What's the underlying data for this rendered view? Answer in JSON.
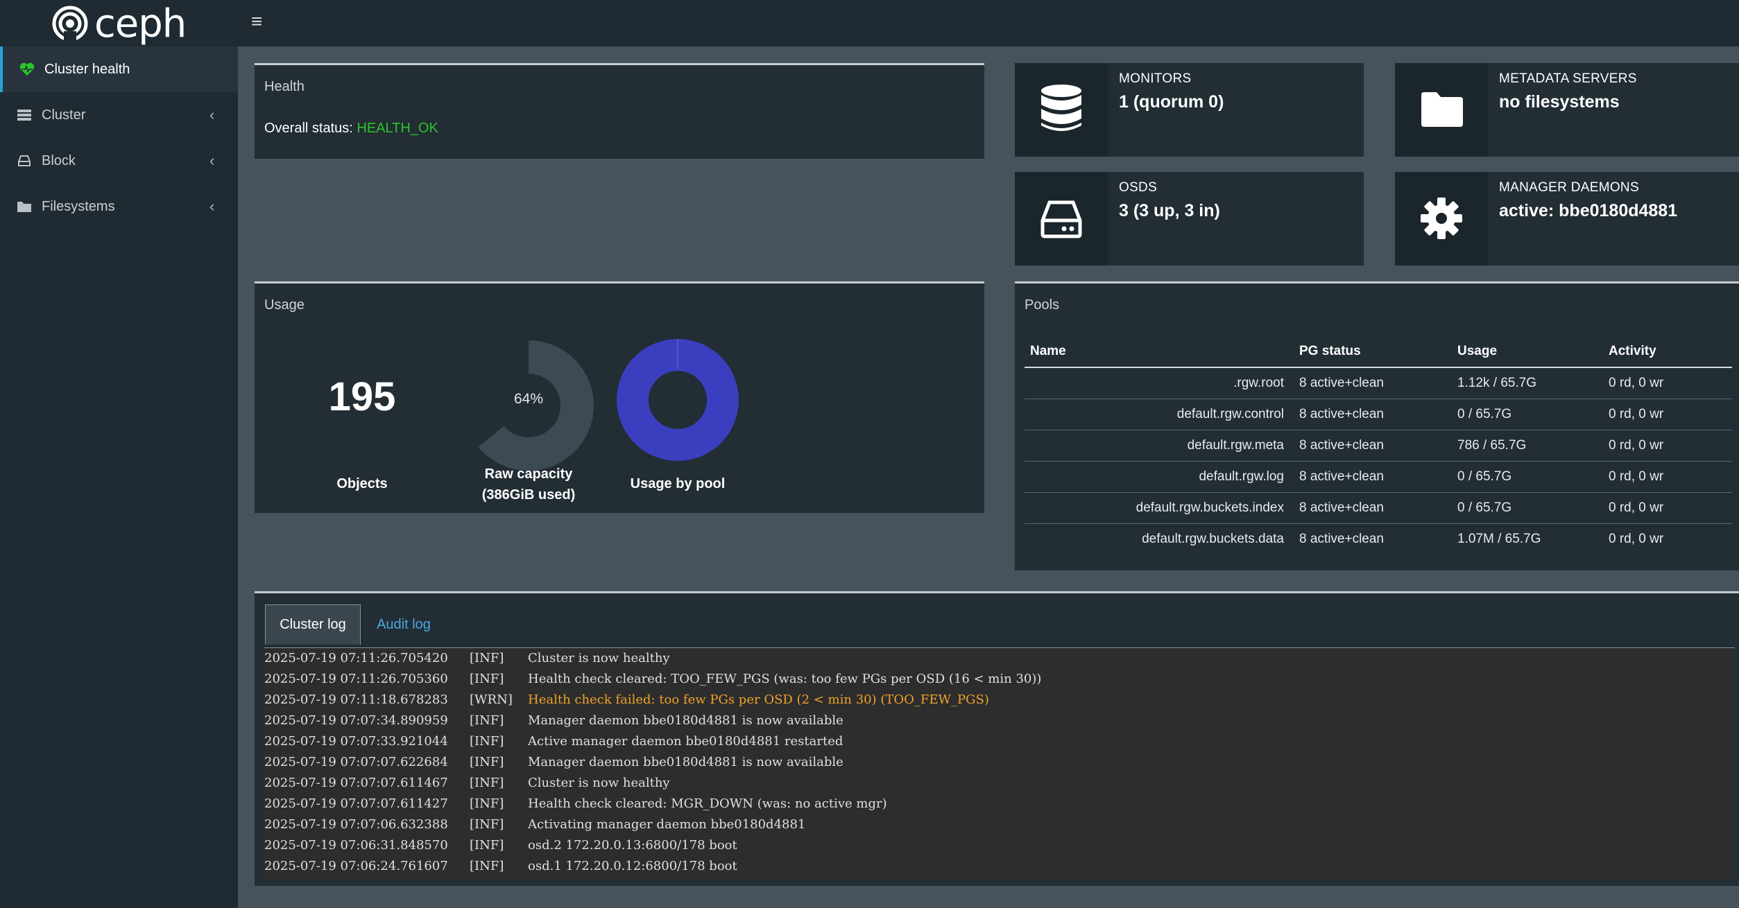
{
  "app": {
    "logo_text": "ceph",
    "menu_icon": "hamburger-icon"
  },
  "sidebar": {
    "items": [
      {
        "label": "Cluster health",
        "icon": "heart-pulse-icon",
        "active": true
      },
      {
        "label": "Cluster",
        "icon": "server-stack-icon"
      },
      {
        "label": "Block",
        "icon": "hdd-icon"
      },
      {
        "label": "Filesystems",
        "icon": "folder-icon"
      }
    ]
  },
  "health": {
    "title": "Health",
    "status_label": "Overall status:",
    "status_value": "HEALTH_OK"
  },
  "stats": {
    "monitors": {
      "label": "MONITORS",
      "value": "1 (quorum 0)",
      "icon": "database-icon"
    },
    "metadata": {
      "label": "METADATA SERVERS",
      "value": "no filesystems",
      "icon": "folder-icon"
    },
    "osds": {
      "label": "OSDS",
      "value": "3 (3 up, 3 in)",
      "icon": "hard-drive-icon"
    },
    "managers": {
      "label": "MANAGER DAEMONS",
      "value": "active: bbe0180d4881",
      "icon": "gear-icon"
    }
  },
  "usage": {
    "title": "Usage",
    "objects_value": "195",
    "objects_label": "Objects",
    "raw_percent_text": "64%",
    "raw_fraction": 0.64,
    "raw_label_line1": "Raw capacity",
    "raw_label_line2": "(386GiB used)",
    "pool_label": "Usage by pool",
    "colors": {
      "used": "#3c4a54",
      "pool": "#3b3fbf"
    }
  },
  "pools": {
    "title": "Pools",
    "headers": [
      "Name",
      "PG status",
      "Usage",
      "Activity"
    ],
    "rows": [
      {
        "name": ".rgw.root",
        "pg": "8 active+clean",
        "usage": "1.12k / 65.7G",
        "activity": "0 rd, 0 wr"
      },
      {
        "name": "default.rgw.control",
        "pg": "8 active+clean",
        "usage": "0 / 65.7G",
        "activity": "0 rd, 0 wr"
      },
      {
        "name": "default.rgw.meta",
        "pg": "8 active+clean",
        "usage": "786 / 65.7G",
        "activity": "0 rd, 0 wr"
      },
      {
        "name": "default.rgw.log",
        "pg": "8 active+clean",
        "usage": "0 / 65.7G",
        "activity": "0 rd, 0 wr"
      },
      {
        "name": "default.rgw.buckets.index",
        "pg": "8 active+clean",
        "usage": "0 / 65.7G",
        "activity": "0 rd, 0 wr"
      },
      {
        "name": "default.rgw.buckets.data",
        "pg": "8 active+clean",
        "usage": "1.07M / 65.7G",
        "activity": "0 rd, 0 wr"
      }
    ]
  },
  "logs": {
    "tabs": [
      "Cluster log",
      "Audit log"
    ],
    "lines": [
      {
        "ts": "2025-07-19 07:11:26.705420",
        "level": "[INF]",
        "msg": "Cluster is now healthy"
      },
      {
        "ts": "2025-07-19 07:11:26.705360",
        "level": "[INF]",
        "msg": "Health check cleared: TOO_FEW_PGS (was: too few PGs per OSD (16 < min 30))"
      },
      {
        "ts": "2025-07-19 07:11:18.678283",
        "level": "[WRN]",
        "msg": "Health check failed: too few PGs per OSD (2 < min 30) (TOO_FEW_PGS)"
      },
      {
        "ts": "2025-07-19 07:07:34.890959",
        "level": "[INF]",
        "msg": "Manager daemon bbe0180d4881 is now available"
      },
      {
        "ts": "2025-07-19 07:07:33.921044",
        "level": "[INF]",
        "msg": "Active manager daemon bbe0180d4881 restarted"
      },
      {
        "ts": "2025-07-19 07:07:07.622684",
        "level": "[INF]",
        "msg": "Manager daemon bbe0180d4881 is now available"
      },
      {
        "ts": "2025-07-19 07:07:07.611467",
        "level": "[INF]",
        "msg": "Cluster is now healthy"
      },
      {
        "ts": "2025-07-19 07:07:07.611427",
        "level": "[INF]",
        "msg": "Health check cleared: MGR_DOWN (was: no active mgr)"
      },
      {
        "ts": "2025-07-19 07:07:06.632388",
        "level": "[INF]",
        "msg": "Activating manager daemon bbe0180d4881"
      },
      {
        "ts": "2025-07-19 07:06:31.848570",
        "level": "[INF]",
        "msg": "osd.2 172.20.0.13:6800/178 boot"
      },
      {
        "ts": "2025-07-19 07:06:24.761607",
        "level": "[INF]",
        "msg": "osd.1 172.20.0.12:6800/178 boot"
      }
    ]
  }
}
